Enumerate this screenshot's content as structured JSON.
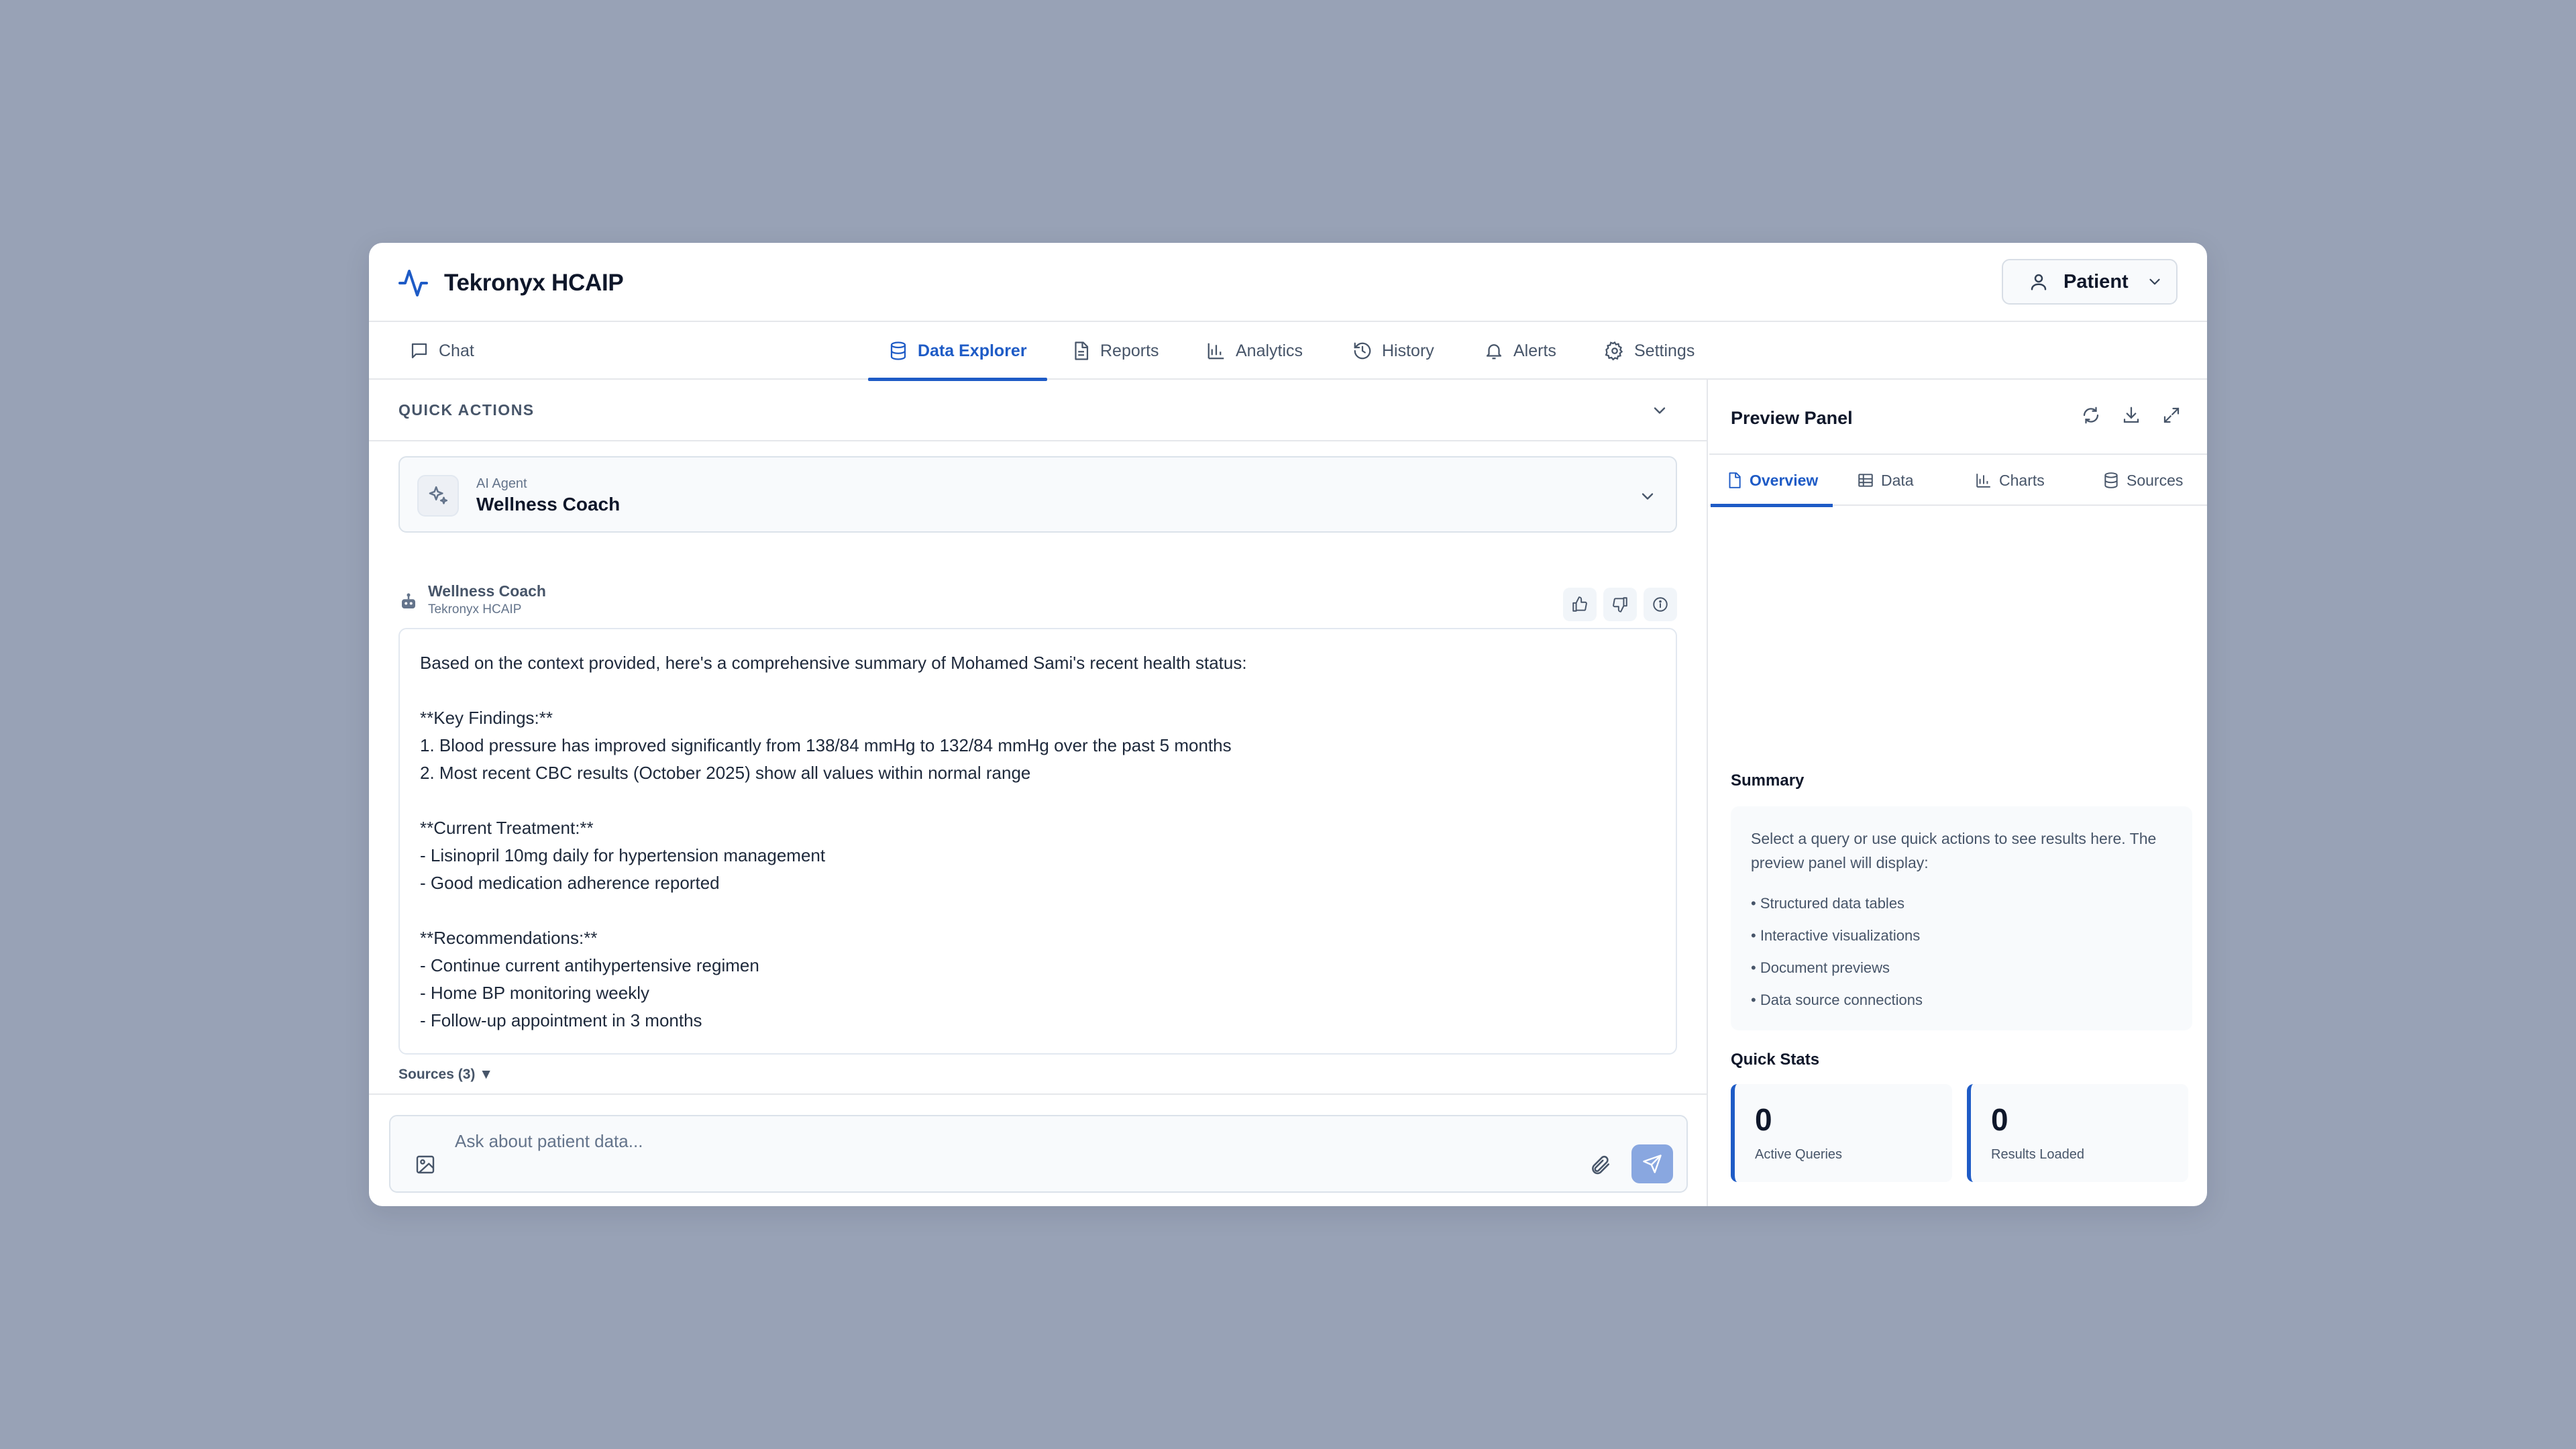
{
  "app": {
    "title": "Tekronyx HCAIP",
    "role_label": "Patient"
  },
  "nav": {
    "tabs": [
      {
        "label": "Chat",
        "icon": "chat-icon"
      },
      {
        "label": "Data Explorer",
        "icon": "database-icon",
        "active": true
      },
      {
        "label": "Reports",
        "icon": "document-icon"
      },
      {
        "label": "Analytics",
        "icon": "bar-chart-icon"
      },
      {
        "label": "History",
        "icon": "history-icon"
      },
      {
        "label": "Alerts",
        "icon": "bell-icon"
      },
      {
        "label": "Settings",
        "icon": "gear-icon"
      }
    ]
  },
  "quick_actions": {
    "title": "QUICK ACTIONS"
  },
  "agent": {
    "label": "AI Agent",
    "name": "Wellness Coach"
  },
  "message": {
    "sender": "Wellness Coach",
    "sub": "Tekronyx HCAIP",
    "lines": [
      "Based on the context provided, here's a comprehensive summary of Mohamed Sami's recent health status:",
      "",
      "**Key Findings:**",
      "1. Blood pressure has improved significantly from 138/84 mmHg to 132/84 mmHg over the past 5 months",
      "2. Most recent CBC results (October 2025) show all values within normal range",
      "",
      "**Current Treatment:**",
      "- Lisinopril 10mg daily for hypertension management",
      "- Good medication adherence reported",
      "",
      "**Recommendations:**",
      "- Continue current antihypertensive regimen",
      "- Home BP monitoring weekly",
      "- Follow-up appointment in 3 months"
    ],
    "sources_label": "Sources (3) ▼"
  },
  "composer": {
    "placeholder": "Ask about patient data..."
  },
  "preview": {
    "title": "Preview Panel",
    "tabs": [
      {
        "label": "Overview",
        "active": true
      },
      {
        "label": "Data"
      },
      {
        "label": "Charts"
      },
      {
        "label": "Sources"
      }
    ],
    "summary_title": "Summary",
    "summary_intro": "Select a query or use quick actions to see results here. The preview panel will display:",
    "summary_items": [
      "• Structured data tables",
      "• Interactive visualizations",
      "• Document previews",
      "• Data source connections"
    ],
    "quick_stats_title": "Quick Stats",
    "stats": [
      {
        "value": "0",
        "label": "Active Queries"
      },
      {
        "value": "0",
        "label": "Results Loaded"
      }
    ]
  },
  "colors": {
    "accent": "#1e5bc6",
    "background": "#98a2b6",
    "send_button": "#89a7e0"
  }
}
